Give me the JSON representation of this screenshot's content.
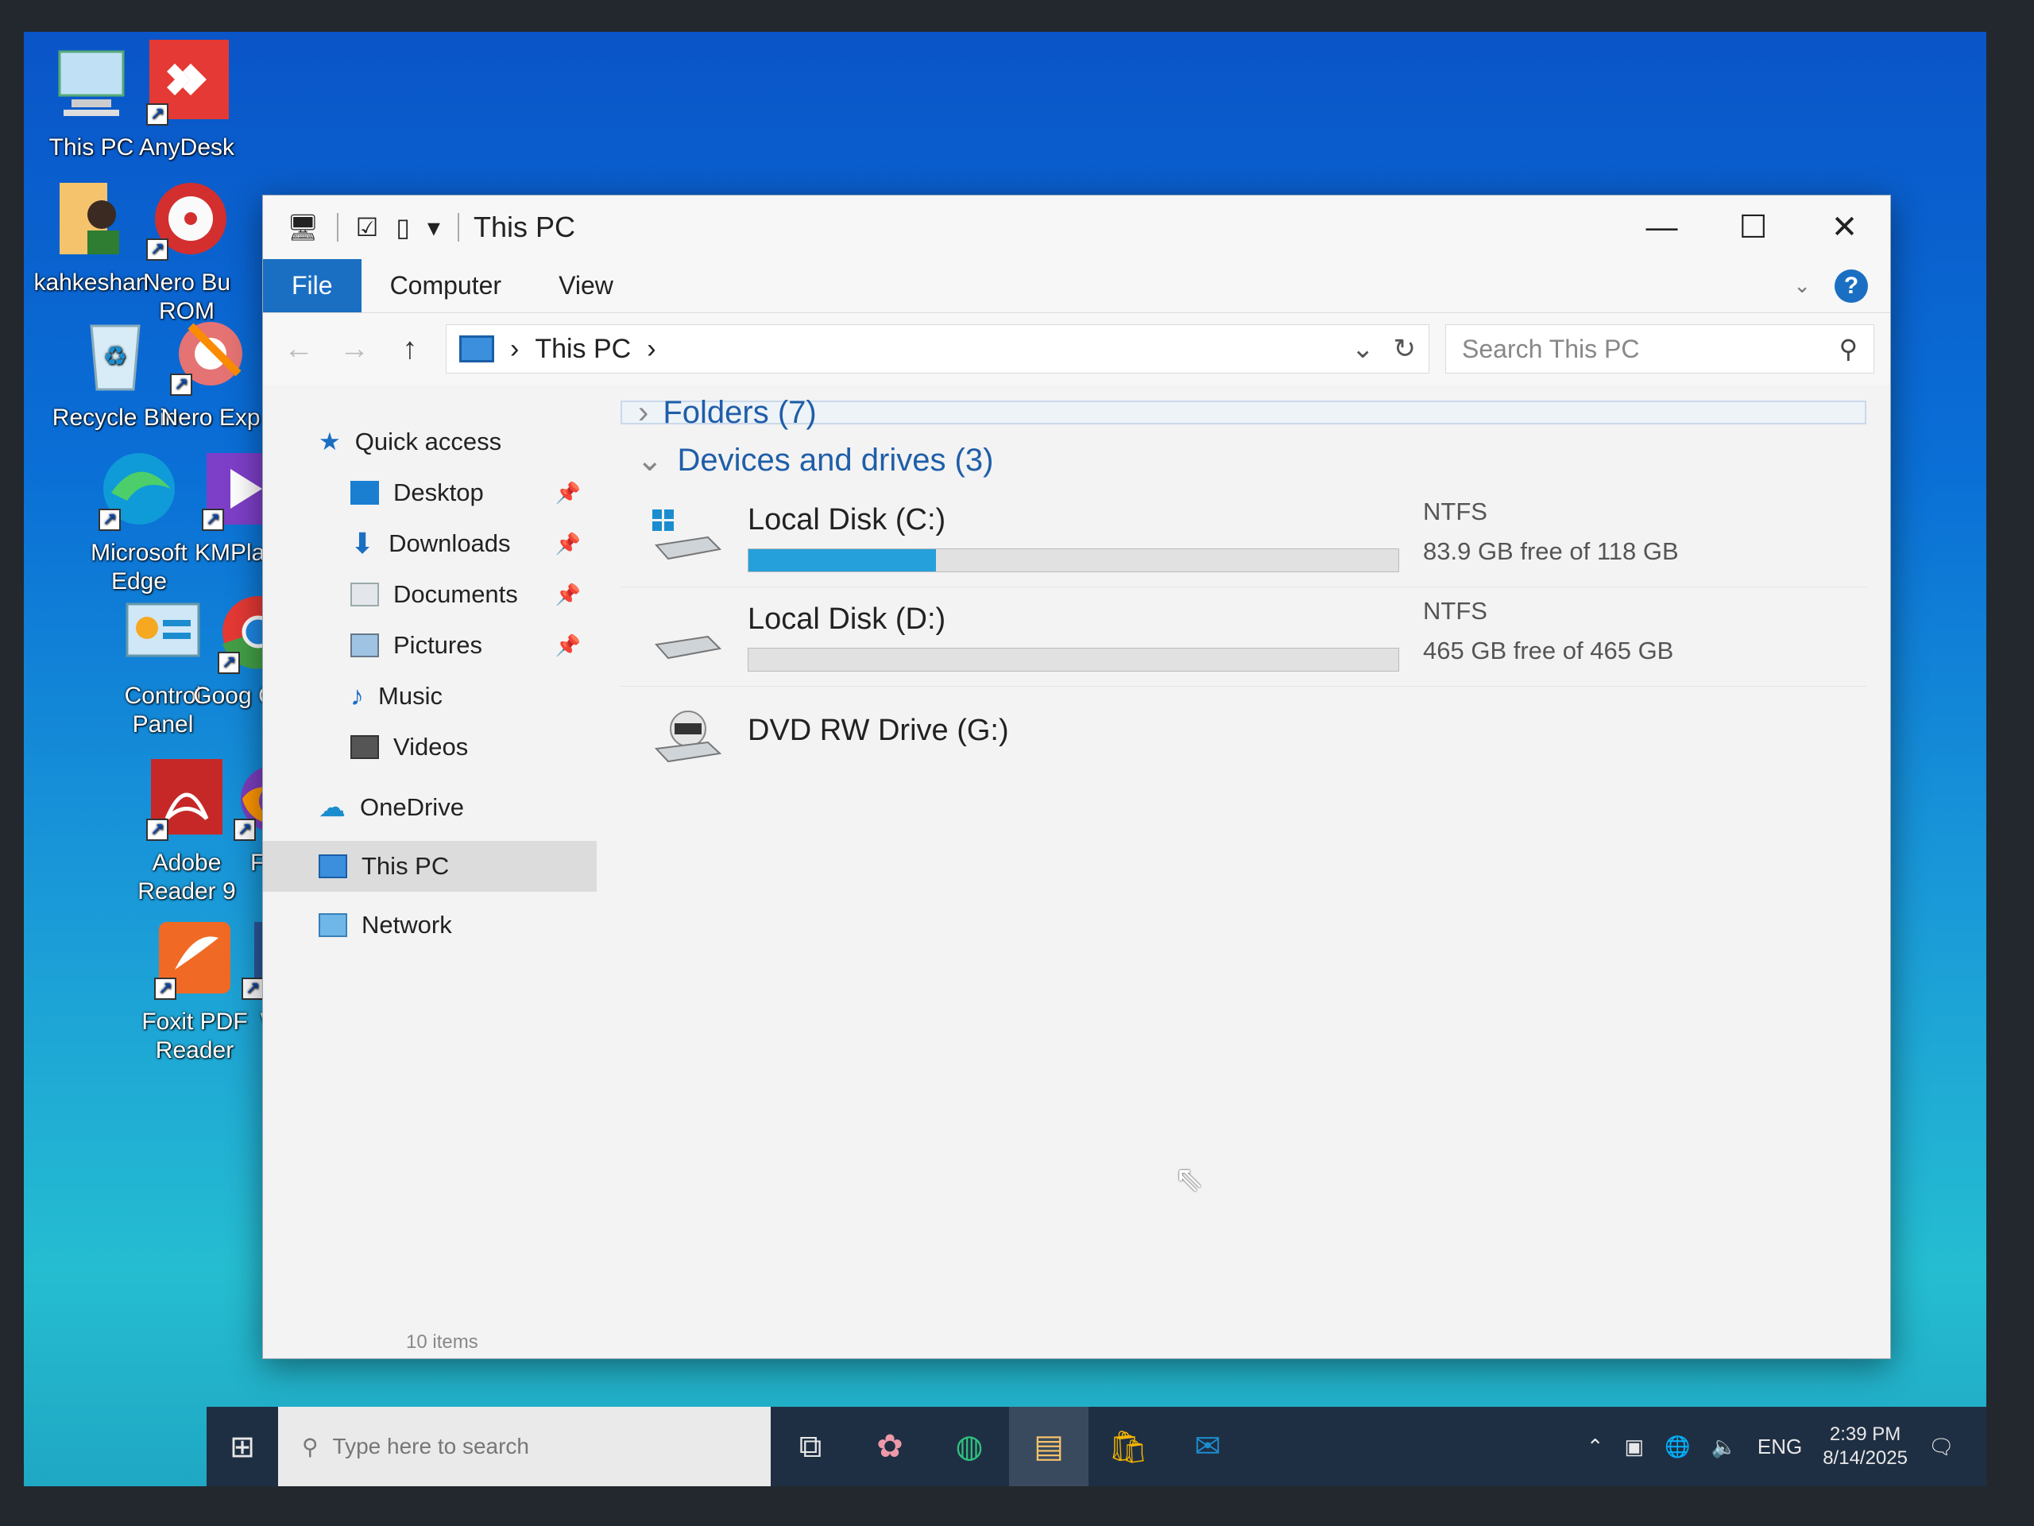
{
  "desktop": {
    "icons": [
      {
        "label": "This PC",
        "icon": "this-pc-icon"
      },
      {
        "label": "AnyDesk",
        "icon": "anydesk-icon"
      },
      {
        "label": "kahkeshan",
        "icon": "user-folder-icon"
      },
      {
        "label": "Nero Bu ROM",
        "icon": "nero-burning-rom-icon"
      },
      {
        "label": "Recycle Bin",
        "icon": "recycle-bin-icon"
      },
      {
        "label": "Nero Exp",
        "icon": "nero-express-icon"
      },
      {
        "label": "Microsoft Edge",
        "icon": "edge-icon"
      },
      {
        "label": "KMPlaye",
        "icon": "kmplayer-icon"
      },
      {
        "label": "Control Panel",
        "icon": "control-panel-icon"
      },
      {
        "label": "Goog Chron",
        "icon": "chrome-icon"
      },
      {
        "label": "Adobe Reader 9",
        "icon": "adobe-reader-icon"
      },
      {
        "label": "Firef",
        "icon": "firefox-icon"
      },
      {
        "label": "Foxit PDF Reader",
        "icon": "foxit-reader-icon"
      },
      {
        "label": "Wor",
        "icon": "word-icon"
      }
    ]
  },
  "window": {
    "title": "This PC",
    "ribbon_tabs": [
      "File",
      "Computer",
      "View"
    ],
    "address": {
      "location": "This PC"
    },
    "search": {
      "placeholder": "Search This PC"
    },
    "nav": {
      "quick_access": "Quick access",
      "items": [
        "Desktop",
        "Downloads",
        "Documents",
        "Pictures",
        "Music",
        "Videos"
      ],
      "onedrive": "OneDrive",
      "this_pc": "This PC",
      "network": "Network"
    },
    "groups": {
      "folders": "Folders (7)",
      "devices": "Devices and drives (3)"
    },
    "drives": [
      {
        "name": "Local Disk (C:)",
        "fs": "NTFS",
        "free_text": "83.9 GB free of 118 GB",
        "used_fraction": 0.289
      },
      {
        "name": "Local Disk (D:)",
        "fs": "NTFS",
        "free_text": "465 GB free of 465 GB",
        "used_fraction": 0.0
      },
      {
        "name": "DVD RW Drive (G:)",
        "fs": "",
        "free_text": ""
      }
    ],
    "status": "10 items"
  },
  "taskbar": {
    "search_placeholder": "Type here to search",
    "language": "ENG",
    "time": "2:39 PM",
    "date": "8/14/2025"
  },
  "colors": {
    "accent": "#1b6fc2",
    "drive_bar": "#26a0da"
  }
}
